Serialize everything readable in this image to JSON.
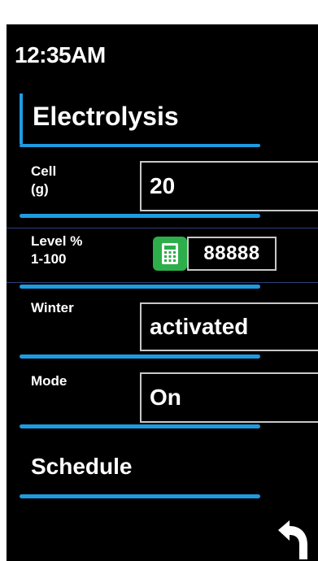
{
  "status": {
    "time": "12:35AM"
  },
  "header": {
    "title": "Electrolysis"
  },
  "rows": {
    "cell": {
      "label_line1": "Cell",
      "label_line2": "(g)",
      "value": "20"
    },
    "level": {
      "label_line1": "Level %",
      "label_line2": "1-100",
      "value": "88888"
    },
    "winter": {
      "label": "Winter",
      "value": "activated"
    },
    "mode": {
      "label": "Mode",
      "value": "On"
    }
  },
  "schedule": {
    "label": "Schedule"
  },
  "icons": {
    "keypad": "keypad-icon",
    "back": "back-arrow-icon"
  },
  "colors": {
    "accent": "#1e9be0",
    "keypad_green": "#2eae4a",
    "background": "#000000"
  }
}
